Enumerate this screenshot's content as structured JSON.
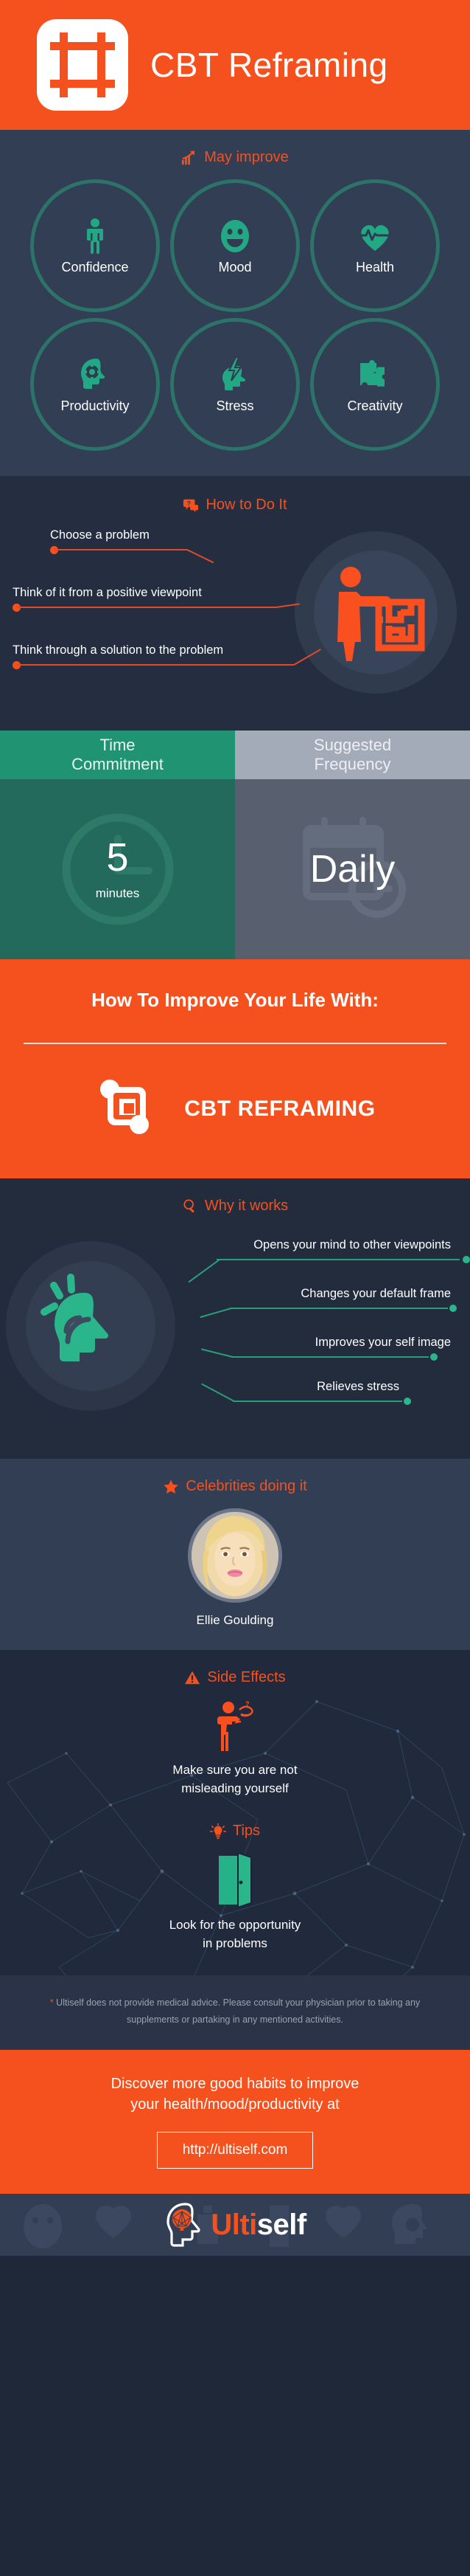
{
  "header": {
    "title": "CBT Reframing",
    "logo_icon": "crop-frame-icon"
  },
  "may_improve": {
    "heading": "May improve",
    "heading_icon": "growth-chart-arrow-icon",
    "items": [
      {
        "label": "Confidence",
        "icon": "person-standing-icon"
      },
      {
        "label": "Mood",
        "icon": "smiley-face-icon"
      },
      {
        "label": "Health",
        "icon": "heart-pulse-icon"
      },
      {
        "label": "Productivity",
        "icon": "head-gear-icon"
      },
      {
        "label": "Stress",
        "icon": "head-lightning-icon"
      },
      {
        "label": "Creativity",
        "icon": "puzzle-pieces-icon"
      }
    ]
  },
  "how_to": {
    "heading": "How to Do It",
    "heading_icon": "question-speech-bubble-icon",
    "illustration_icon": "person-pointing-at-maze-icon",
    "steps": [
      "Choose a problem",
      "Think of it from a positive viewpoint",
      "Think through a solution to the problem"
    ]
  },
  "time_frequency": {
    "time": {
      "header": "Time\nCommitment",
      "header_line1": "Time",
      "header_line2": "Commitment",
      "value": "5",
      "unit": "minutes",
      "watermark_icon": "clock-icon",
      "header_color": "#209372",
      "body_color": "#236a5c"
    },
    "frequency": {
      "header_line1": "Suggested",
      "header_line2": "Frequency",
      "value": "Daily",
      "watermark_icon": "calendar-clock-icon",
      "header_color": "#a3aab8",
      "body_color": "#58606f"
    }
  },
  "brand": {
    "title": "How To Improve Your Life With:",
    "name": "CBT REFRAMING",
    "logo_icon": "crop-frame-icon",
    "bg_color": "#f4511e"
  },
  "why_it_works": {
    "heading": "Why it works",
    "heading_icon": "magnifying-glass-icon",
    "illustration_icon": "thinking-head-waves-icon",
    "benefits": [
      "Opens your mind to other viewpoints",
      "Changes your default frame",
      "Improves your self image",
      "Relieves stress"
    ]
  },
  "celebrities": {
    "heading": "Celebrities doing it",
    "heading_icon": "star-icon",
    "name": "Ellie Goulding",
    "photo_alt": "blonde-woman-portrait"
  },
  "side_effects": {
    "heading": "Side Effects",
    "heading_icon": "warning-triangle-icon",
    "illustration_icon": "confused-person-icon",
    "text_line1": "Make sure you are not",
    "text_line2": "misleading yourself"
  },
  "tips": {
    "heading": "Tips",
    "heading_icon": "lightbulb-icon",
    "illustration_icon": "open-door-icon",
    "text_line1": "Look for the opportunity",
    "text_line2": "in problems"
  },
  "disclaimer": {
    "star": "*",
    "text": " Ultiself does not provide medical advice. Please consult your physician prior to taking any supplements or partaking in any mentioned activities."
  },
  "cta": {
    "line1": "Discover more good habits to improve",
    "line2": "your health/mood/productivity at",
    "button": "http://ultiself.com"
  },
  "footer": {
    "brand_part1": "Ulti",
    "brand_part2": "self",
    "logo_icon": "head-brain-outline-icon"
  },
  "colors": {
    "orange": "#f4511e",
    "teal": "#2ab68a",
    "dark_navy": "#232c3d",
    "panel_navy": "#323e53",
    "green": "#209372",
    "gray_blue": "#a3aab8"
  }
}
